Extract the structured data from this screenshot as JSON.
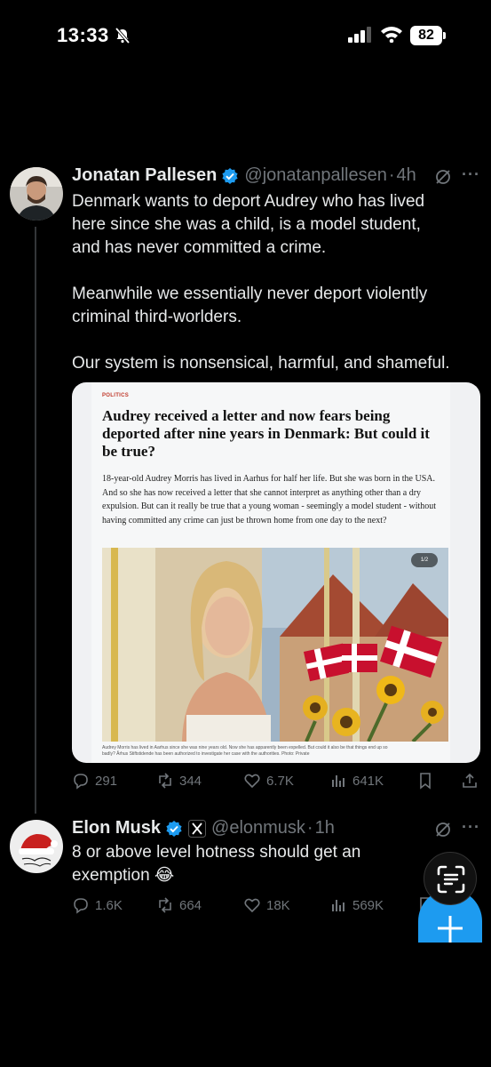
{
  "status_bar": {
    "time": "13:33",
    "battery": "82"
  },
  "tweet1": {
    "name": "Jonatan Pallesen",
    "handle": "@jonatanpallesen",
    "separator": "·",
    "time": "4h",
    "text": "Denmark wants to deport Audrey who has lived\nhere since she was a child, is a model student,\nand has never committed a crime.\n\nMeanwhile we essentially never deport violently\ncriminal third-worlders.\n\nOur system is nonsensical, harmful, and shameful.",
    "article": {
      "category": "POLITICS",
      "headline": "Audrey received a letter and now fears being deported after nine years in Denmark: But could it be true?",
      "lede": "18-year-old Audrey Morris has lived in Aarhus for half her life. But she was born in the USA. And so she has now received a letter that she cannot interpret as anything other than a dry expulsion. But can it really be true that a young woman - seemingly a model student - without having committed any crime can just be thrown home from one day to the next?",
      "photo_counter": "1/2",
      "caption": "Audrey Morris has lived in Aarhus since she was nine years old. Now she has apparently been expelled. But could it also be that things end up so badly? Århus Stiftstidende has been authorized to investigate her case with the authorities. Photo: Private"
    },
    "actions": {
      "replies": "291",
      "reposts": "344",
      "likes": "6.7K",
      "views": "641K"
    }
  },
  "tweet2": {
    "name": "Elon Musk",
    "handle": "@elonmusk",
    "separator": "·",
    "time": "1h",
    "text": "8 or above level hotness should get an\nexemption 😂",
    "actions": {
      "replies": "1.6K",
      "reposts": "664",
      "likes": "18K",
      "views": "569K"
    }
  },
  "colors": {
    "background": "#000000",
    "text": "#e7e9ea",
    "muted": "#71767b",
    "verified": "#1d9bf0"
  }
}
